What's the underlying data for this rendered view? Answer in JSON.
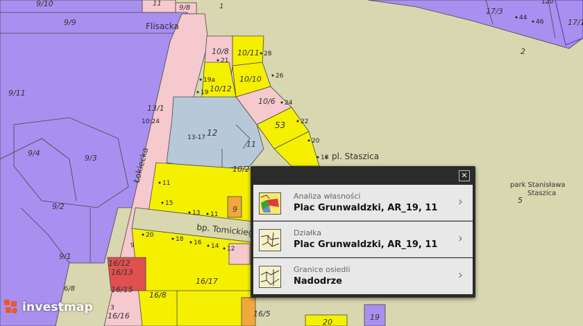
{
  "map": {
    "streets": {
      "flisacka": "Flisacka",
      "lokiecka": "Łokiecka",
      "pl_staszica": "pl. Staszica",
      "bp_tomickiego": "bp. Tomickiego",
      "park": "park Stanisława",
      "park2": "Staszica"
    },
    "parcels": [
      "9/10",
      "9/9",
      "9/11",
      "9/4",
      "9/3",
      "9/2",
      "9/1",
      "13/1",
      "10:24",
      "11",
      "9/8",
      "1",
      "10/8",
      "10/11",
      "10/12",
      "10/10",
      "10/6",
      "12",
      "13-17",
      "11",
      "10/2",
      "53",
      "9",
      "16/12",
      "16/13",
      "16/15",
      "16/8",
      "16/17",
      "16/16",
      "6/8",
      "16/5",
      "20",
      "19",
      "17/3",
      "2",
      "5",
      "17/1"
    ],
    "house_numbers": [
      "21",
      "28",
      "19a",
      "19",
      "26",
      "24",
      "22",
      "20",
      "18",
      "11",
      "15",
      "13",
      "11",
      "9",
      "20",
      "18",
      "16",
      "14",
      "12",
      "3",
      "44",
      "46",
      "120"
    ]
  },
  "popup": {
    "close_label": "✕",
    "rows": [
      {
        "sub": "Analiza własności",
        "main": "Plac Grunwaldzki, AR_19, 11",
        "icon": "ownership-analysis-icon"
      },
      {
        "sub": "Działka",
        "main": "Plac Grunwaldzki, AR_19, 11",
        "icon": "parcel-icon"
      },
      {
        "sub": "Granice osiedli",
        "main": "Nadodrze",
        "icon": "district-boundary-icon"
      }
    ],
    "chevron": "›"
  },
  "branding": {
    "name": "investmap"
  },
  "colors": {
    "yellow": "#f5f000",
    "purple": "#a98ff0",
    "khaki": "#d9d7b0",
    "pink": "#f5c9ce",
    "lightblue": "#b7c9d9",
    "orange": "#f0a83c",
    "red": "#e0504f"
  }
}
